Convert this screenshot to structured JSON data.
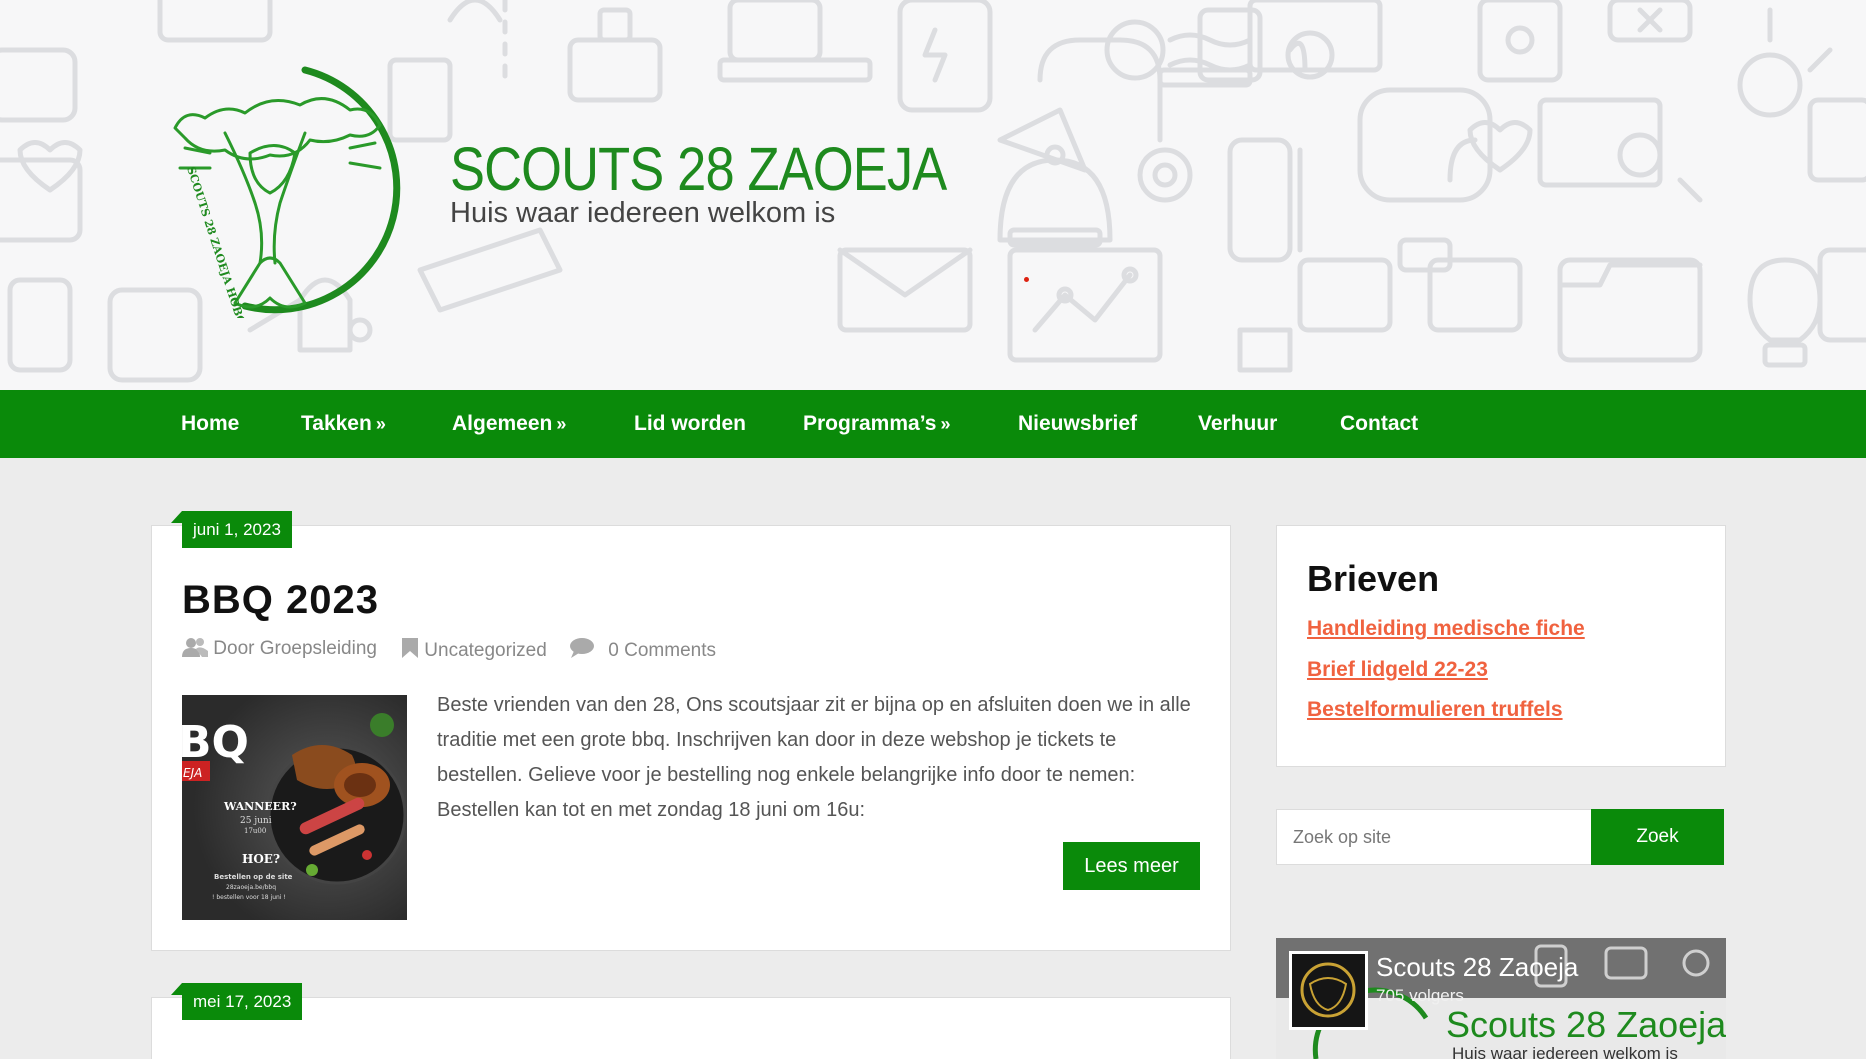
{
  "site": {
    "title": "SCOUTS 28 ZAOEJA",
    "tagline": "Huis waar iedereen welkom is",
    "logo_ring_text": "SCOUTS 28 ZAOEJA HOBOKEN"
  },
  "nav": {
    "items": [
      {
        "label": "Home",
        "has_submenu": false
      },
      {
        "label": "Takken",
        "has_submenu": true
      },
      {
        "label": "Algemeen",
        "has_submenu": true
      },
      {
        "label": "Lid worden",
        "has_submenu": false
      },
      {
        "label": "Programma’s",
        "has_submenu": true
      },
      {
        "label": "Nieuwsbrief",
        "has_submenu": false
      },
      {
        "label": "Verhuur",
        "has_submenu": false
      },
      {
        "label": "Contact",
        "has_submenu": false
      }
    ],
    "chevron": "»"
  },
  "posts": [
    {
      "date": "juni 1, 2023",
      "title": "BBQ 2023",
      "author": "Door Groepsleiding",
      "category": "Uncategorized",
      "comments": "0 Comments",
      "excerpt": "Beste vrienden van den 28, Ons scoutsjaar zit er bijna op en afsluiten doen we in alle traditie met een grote bbq. Inschrijven kan door in deze webshop je tickets te bestellen. Gelieve voor je bestelling nog enkele belangrijke info door te nemen: Bestellen kan tot en met zondag 18 juni om 16u:",
      "read_more": "Lees meer",
      "thumbnail": {
        "big": "BQ",
        "tag": "EJA",
        "q1": "WANNEER?",
        "a1": "25 juni",
        "a1b": "17u00",
        "q2": "HOE?",
        "a2": "Bestellen op de site",
        "a2b": "28zaoeja.be/bbq",
        "a2c": "! bestellen voor 18 juni !"
      }
    },
    {
      "date": "mei 17, 2023",
      "title": ""
    }
  ],
  "sidebar": {
    "brieven": {
      "title": "Brieven",
      "links": [
        "Handleiding medische fiche",
        "Brief lidgeld 22-23",
        "Bestelformulieren truffels"
      ]
    },
    "search": {
      "placeholder": "Zoek op site",
      "button": "Zoek"
    },
    "facebook": {
      "name": "Scouts 28 Zaoeja",
      "followers": "705 volgers",
      "cover_title": "Scouts 28 Zaoeja",
      "cover_subtitle": "Huis waar iedereen welkom is"
    }
  },
  "colors": {
    "brand_green": "#0a8a0a",
    "logo_green": "#1e8a1e",
    "link_orange": "#f0623f"
  }
}
